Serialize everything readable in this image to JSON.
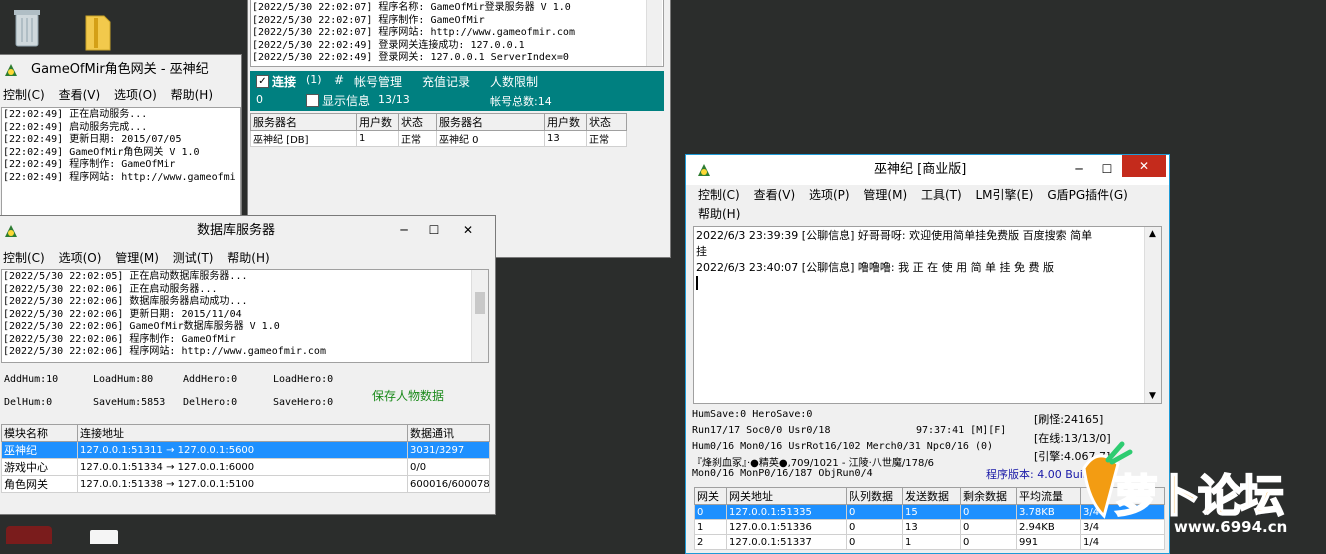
{
  "desktop": {
    "icons": [
      "recycle-bin-icon",
      "folder-icon"
    ]
  },
  "gate_window": {
    "title": "GameOfMir角色网关 - 巫神纪",
    "menu": [
      "控制(C)",
      "查看(V)",
      "选项(O)",
      "帮助(H)"
    ],
    "log": [
      "[22:02:49] 正在启动服务...",
      "[22:02:49] 启动服务完成...",
      "[22:02:49] 更新日期: 2015/07/05",
      "[22:02:49] GameOfMir角色网关 V 1.0",
      "[22:02:49] 程序制作: GameOfMir",
      "[22:02:49] 程序网站: http://www.gameofmi"
    ]
  },
  "login_window": {
    "log": [
      "[2022/5/30 22:02:07] 程序名称: GameOfMir登录服务器 V 1.0",
      "[2022/5/30 22:02:07] 程序制作: GameOfMir",
      "[2022/5/30 22:02:07] 程序网站: http://www.gameofmir.com",
      "[2022/5/30 22:02:49] 登录网关连接成功: 127.0.0.1",
      "[2022/5/30 22:02:49] 登录网关: 127.0.0.1 ServerIndex=0"
    ],
    "toolbar": {
      "connect_label": "连接",
      "connect_count": "(1)",
      "hash": "#",
      "account_mgmt": "帐号管理",
      "recharge": "充值记录",
      "user_limit": "人数限制",
      "zero": "0",
      "show_info": "显示信息",
      "ratio": "13/13",
      "total_accounts": "帐号总数:14"
    },
    "table": {
      "headers": [
        "服务器名",
        "用户数",
        "状态",
        "服务器名",
        "用户数",
        "状态"
      ],
      "rows": [
        [
          "巫神纪 [DB]",
          "1",
          "正常",
          "巫神纪 0",
          "13",
          "正常"
        ]
      ]
    }
  },
  "db_window": {
    "title": "数据库服务器",
    "controls": [
      "─",
      "☐",
      "✕"
    ],
    "menu": [
      "控制(C)",
      "选项(O)",
      "管理(M)",
      "测试(T)",
      "帮助(H)"
    ],
    "log": [
      "[2022/5/30 22:02:05] 正在启动数据库服务器...",
      "[2022/5/30 22:02:06] 正在启动服务器...",
      "[2022/5/30 22:02:06] 数据库服务器启动成功...",
      "[2022/5/30 22:02:06] 更新日期: 2015/11/04",
      "[2022/5/30 22:02:06] GameOfMir数据库服务器 V 1.0",
      "[2022/5/30 22:02:06] 程序制作: GameOfMir",
      "[2022/5/30 22:02:06] 程序网站: http://www.gameofmir.com"
    ],
    "stats": {
      "add_hum": "AddHum:10",
      "load_hum": "LoadHum:80",
      "add_hero": "AddHero:0",
      "load_hero": "LoadHero:0",
      "del_hum": "DelHum:0",
      "save_hum": "SaveHum:5853",
      "del_hero": "DelHero:0",
      "save_hero": "SaveHero:0",
      "save_button": "保存人物数据"
    },
    "table": {
      "headers": [
        "模块名称",
        "连接地址",
        "数据通讯"
      ],
      "rows": [
        [
          "巫神纪",
          "127.0.0.1:51311 → 127.0.0.1:5600",
          "3031/3297"
        ],
        [
          "游戏中心",
          "127.0.0.1:51334 → 127.0.0.1:6000",
          "0/0"
        ],
        [
          "角色网关",
          "127.0.0.1:51338 → 127.0.0.1:5100",
          "600016/600078"
        ]
      ]
    }
  },
  "m2_window": {
    "title": "巫神纪 [商业版]",
    "controls": [
      "─",
      "☐",
      "✕"
    ],
    "menu1": [
      "控制(C)",
      "查看(V)",
      "选项(P)",
      "管理(M)",
      "工具(T)",
      "LM引擎(E)",
      "G盾PG插件(G)"
    ],
    "menu2": [
      "帮助(H)"
    ],
    "chat": [
      "2022/6/3 23:39:39 [公聊信息] 好哥哥呀: 欢迎使用简单挂免费版 百度搜索 简单",
      "挂",
      "2022/6/3 23:40:07 [公聊信息] 噜噜噜: 我 正 在 使 用 简 单 挂 免 费 版"
    ],
    "status": {
      "line1": "HumSave:0 HeroSave:0",
      "line2": "Run17/17 Soc0/0 Usr0/18",
      "time": "97:37:41 [M][F]",
      "line3": "Hum0/16 Mon0/16 UsrRot16/102 Merch0/31 Npc0/16 (0)",
      "line4": "『烽刹血冢』·●精英●,709/1021 - 江陵·八世魔/178/6",
      "line5": "Mon0/16 MonP0/16/187 ObjRun0/4",
      "monster": "[刷怪:24165]",
      "online": "[在线:13/13/0]",
      "engine": "[引擎:4.067.7]",
      "version": "程序版本: 4.00 Build"
    },
    "table": {
      "headers": [
        "网关",
        "网关地址",
        "队列数据",
        "发送数据",
        "剩余数据",
        "平均流量",
        ""
      ],
      "rows": [
        [
          "0",
          "127.0.0.1:51335",
          "0",
          "15",
          "0",
          "3.78KB",
          "3/4"
        ],
        [
          "1",
          "127.0.0.1:51336",
          "0",
          "13",
          "0",
          "2.94KB",
          "3/4"
        ],
        [
          "2",
          "127.0.0.1:51337",
          "0",
          "1",
          "0",
          "991",
          "1/4"
        ]
      ]
    }
  },
  "watermark": {
    "logo_text": "萝卜论坛",
    "url": "www.6994.cn"
  }
}
